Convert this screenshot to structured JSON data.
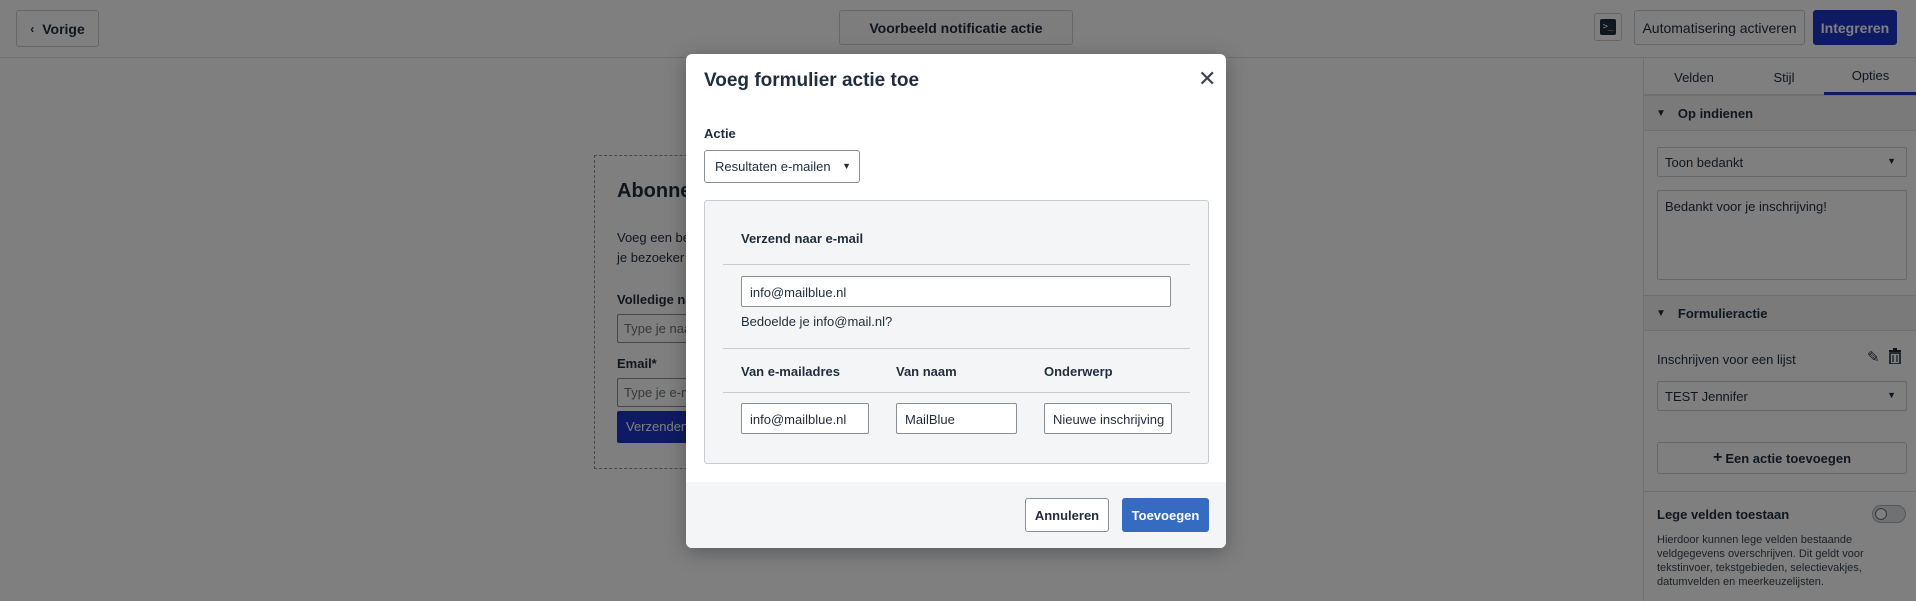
{
  "topbar": {
    "back_label": "Vorige",
    "preview_label": "Voorbeeld notificatie actie",
    "activate_label": "Automatisering activeren",
    "integrate_label": "Integreren",
    "terminal_icon": "terminal-icon"
  },
  "form": {
    "title": "Abonne",
    "desc_line1": "Voeg een be",
    "desc_line2": "je bezoeker a",
    "label_name": "Volledige na",
    "placeholder_name": "Type je naa",
    "label_email": "Email*",
    "placeholder_email": "Type je e-ma",
    "submit_label": "Verzenden"
  },
  "panel": {
    "tabs": [
      {
        "label": "Velden"
      },
      {
        "label": "Stijl"
      },
      {
        "label": "Opties"
      }
    ],
    "section1_title": "Op indienen",
    "on_submit_select": "Toon bedankt",
    "thanks_message": "Bedankt voor je inschrijving!",
    "section2_title": "Formulieractie",
    "action_label": "Inschrijven voor een lijst",
    "list_select": "TEST Jennifer",
    "add_action_label": "Een actie toevoegen",
    "empty_fields_label": "Lege velden toestaan",
    "empty_fields_desc": "Hierdoor kunnen lege velden bestaande veldgegevens overschrijven. Dit geldt voor tekstinvoer, tekstgebieden, selectievakjes, datumvelden en meerkeuzelijsten.",
    "empty_fields_enabled": false
  },
  "modal": {
    "title": "Voeg formulier actie toe",
    "actie_label": "Actie",
    "actie_value": "Resultaten e-mailen",
    "send_to_heading": "Verzend naar e-mail",
    "send_to_value": "info@mailblue.nl",
    "suggestion": "Bedoelde je info@mail.nl?",
    "col_from_email": "Van e-mailadres",
    "col_from_name": "Van naam",
    "col_subject": "Onderwerp",
    "from_email_value": "info@mailblue.nl",
    "from_name_value": "MailBlue",
    "subject_value": "Nieuwe inschrijving",
    "cancel_label": "Annuleren",
    "add_label": "Toevoegen"
  },
  "colors": {
    "primary": "#1e35c9",
    "modal_add": "#356bc0",
    "overlay": "rgba(0,0,0,0.5)"
  }
}
